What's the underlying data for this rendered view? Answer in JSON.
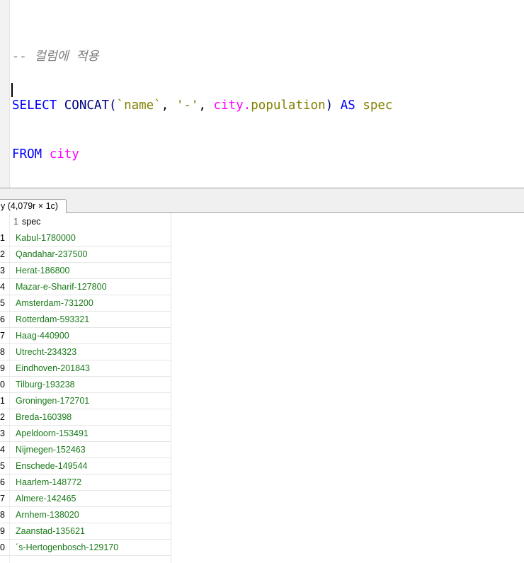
{
  "editor": {
    "comment": "-- 컬럼에 적용",
    "line2": {
      "kw_select": "SELECT",
      "func": "CONCAT",
      "open_paren": "(",
      "ident_name": "`name`",
      "comma1": ",",
      "str_dash": "'-'",
      "comma2": ",",
      "tbl_city": "city",
      "dot": ".",
      "col_population": "population",
      "close_paren": ")",
      "kw_as": "AS",
      "alias": "spec"
    },
    "line3": {
      "kw_from": "FROM",
      "tbl": "city"
    },
    "line4": ";"
  },
  "result_tab": {
    "label": "y (4,079r × 1c)"
  },
  "grid": {
    "header_num": "1",
    "header_name": "spec",
    "rows": [
      {
        "num": "1",
        "value": "Kabul-1780000"
      },
      {
        "num": "2",
        "value": "Qandahar-237500"
      },
      {
        "num": "3",
        "value": "Herat-186800"
      },
      {
        "num": "4",
        "value": "Mazar-e-Sharif-127800"
      },
      {
        "num": "5",
        "value": "Amsterdam-731200"
      },
      {
        "num": "6",
        "value": "Rotterdam-593321"
      },
      {
        "num": "7",
        "value": "Haag-440900"
      },
      {
        "num": "8",
        "value": "Utrecht-234323"
      },
      {
        "num": "9",
        "value": "Eindhoven-201843"
      },
      {
        "num": "0",
        "value": "Tilburg-193238"
      },
      {
        "num": "1",
        "value": "Groningen-172701"
      },
      {
        "num": "2",
        "value": "Breda-160398"
      },
      {
        "num": "3",
        "value": "Apeldoorn-153491"
      },
      {
        "num": "4",
        "value": "Nijmegen-152463"
      },
      {
        "num": "5",
        "value": "Enschede-149544"
      },
      {
        "num": "6",
        "value": "Haarlem-148772"
      },
      {
        "num": "7",
        "value": "Almere-142465"
      },
      {
        "num": "8",
        "value": "Arnhem-138020"
      },
      {
        "num": "9",
        "value": "Zaanstad-135621"
      },
      {
        "num": "0",
        "value": "´s-Hertogenbosch-129170"
      }
    ]
  }
}
